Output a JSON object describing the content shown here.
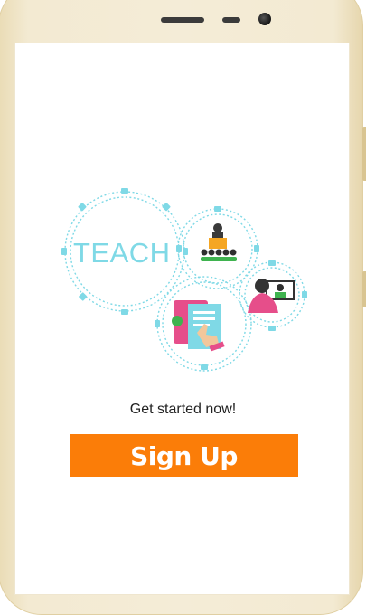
{
  "illustration": {
    "word": "TEACH",
    "colors": {
      "gear_outline": "#7fd9e6",
      "accent_orange": "#f5a623",
      "accent_green": "#3fb34f",
      "accent_pink": "#e64e8a"
    }
  },
  "onboarding": {
    "tagline": "Get started now!",
    "cta_label": "Sign Up",
    "cta_color": "#fb7d08"
  }
}
